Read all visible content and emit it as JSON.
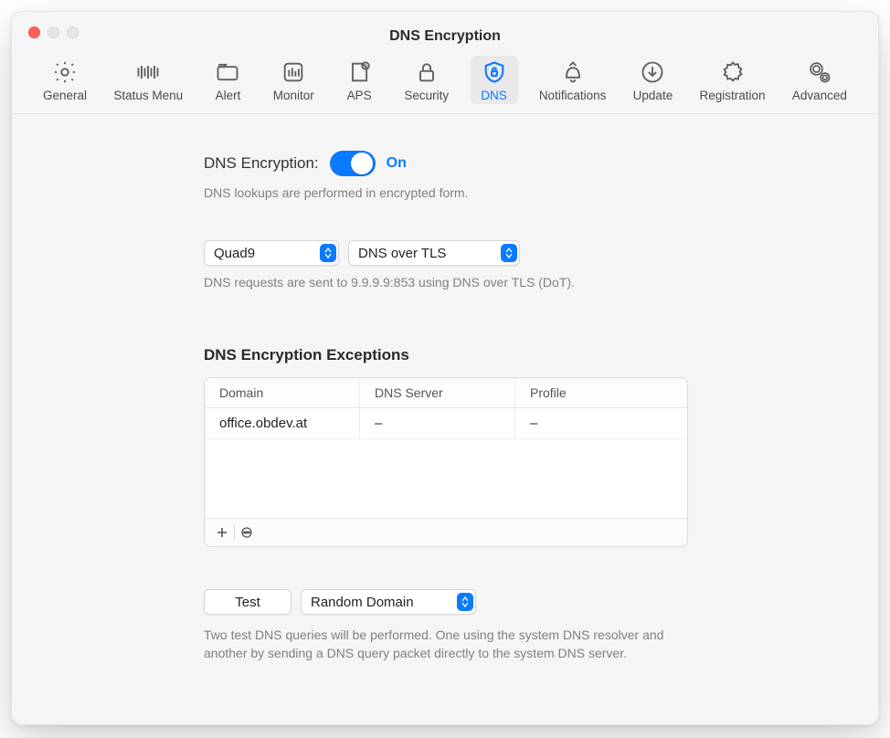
{
  "window": {
    "title": "DNS Encryption"
  },
  "tabs": [
    {
      "label": "General"
    },
    {
      "label": "Status Menu"
    },
    {
      "label": "Alert"
    },
    {
      "label": "Monitor"
    },
    {
      "label": "APS"
    },
    {
      "label": "Security"
    },
    {
      "label": "DNS"
    },
    {
      "label": "Notifications"
    },
    {
      "label": "Update"
    },
    {
      "label": "Registration"
    },
    {
      "label": "Advanced"
    }
  ],
  "dns": {
    "label": "DNS Encryption:",
    "state": "On",
    "desc": "DNS lookups are performed in encrypted form.",
    "provider": "Quad9",
    "method": "DNS over TLS",
    "detail": "DNS requests are sent to 9.9.9.9:853 using DNS over TLS (DoT)."
  },
  "exceptions": {
    "title": "DNS Encryption Exceptions",
    "columns": {
      "domain": "Domain",
      "server": "DNS Server",
      "profile": "Profile"
    },
    "rows": [
      {
        "domain": "office.obdev.at",
        "server": "–",
        "profile": "–"
      }
    ]
  },
  "test": {
    "button": "Test",
    "mode": "Random Domain",
    "hint": "Two test DNS queries will be performed. One using the system DNS resolver and another by sending a DNS query packet directly to the system DNS server."
  }
}
